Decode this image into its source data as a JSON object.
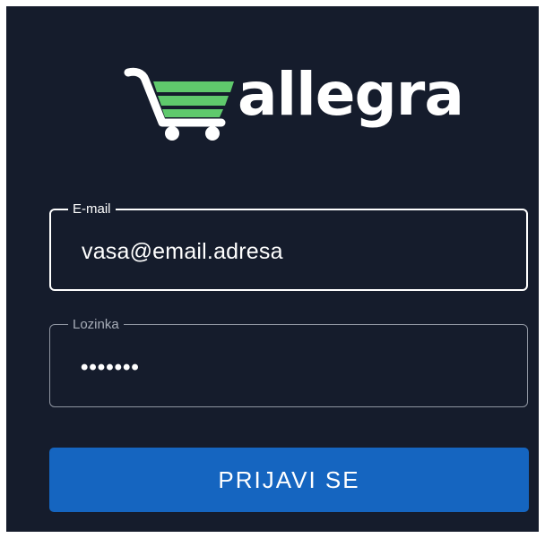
{
  "brand": {
    "name": "allegra",
    "logo_icon": "shopping-cart-icon",
    "cart_color": "#5fc96c",
    "text_color": "#ffffff"
  },
  "form": {
    "email": {
      "label": "E-mail",
      "value": "vasa@email.adresa"
    },
    "password": {
      "label": "Lozinka",
      "value": "•••••••"
    },
    "submit_label": "PRIJAVI SE"
  },
  "colors": {
    "background": "#151c2c",
    "button": "#1565c0",
    "border_active": "#ffffff",
    "border_inactive": "#8f95a1"
  }
}
